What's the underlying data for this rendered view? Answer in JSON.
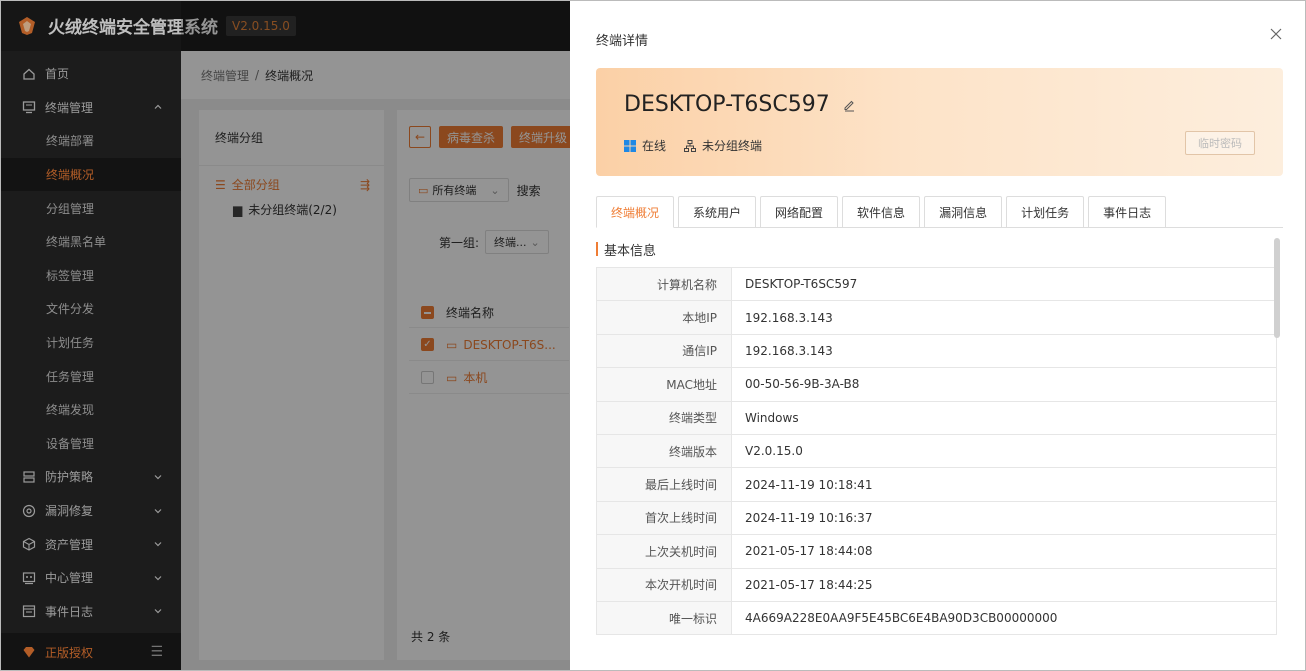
{
  "app": {
    "title": "火绒终端安全管理系统",
    "version": "V2.0.15.0",
    "brand_color": "#ef7d35"
  },
  "sidebar": {
    "items": [
      {
        "label": "首页",
        "icon": "home-icon"
      },
      {
        "label": "终端管理",
        "icon": "monitor-icon",
        "expanded": true
      },
      {
        "label": "防护策略",
        "icon": "shield-policy-icon"
      },
      {
        "label": "漏洞修复",
        "icon": "target-icon"
      },
      {
        "label": "资产管理",
        "icon": "box-icon"
      },
      {
        "label": "中心管理",
        "icon": "server-icon"
      },
      {
        "label": "事件日志",
        "icon": "log-icon"
      }
    ],
    "submenu": [
      {
        "label": "终端部署"
      },
      {
        "label": "终端概况",
        "active": true
      },
      {
        "label": "分组管理"
      },
      {
        "label": "终端黑名单"
      },
      {
        "label": "标签管理"
      },
      {
        "label": "文件分发"
      },
      {
        "label": "计划任务"
      },
      {
        "label": "任务管理"
      },
      {
        "label": "终端发现"
      },
      {
        "label": "设备管理"
      }
    ],
    "footer": {
      "label": "正版授权"
    }
  },
  "main": {
    "breadcrumb": {
      "parent": "终端管理",
      "sep": "/",
      "current": "终端概况"
    },
    "group_panel": {
      "title": "终端分组",
      "all": "全部分组",
      "sub": "未分组终端(2/2)"
    },
    "toolbar": {
      "virus_scan": "病毒查杀",
      "upgrade": "终端升级"
    },
    "filter": {
      "scope": "所有终端",
      "search": "搜索"
    },
    "group_filter": {
      "label": "第一组:",
      "value": "终端..."
    },
    "table": {
      "header": "终端名称",
      "rows": [
        {
          "name": "DESKTOP-T6S...",
          "checked": true
        },
        {
          "name": "本机",
          "checked": false
        }
      ]
    },
    "total": "共 2 条"
  },
  "drawer": {
    "title": "终端详情",
    "hostname": "DESKTOP-T6SC597",
    "status": "在线",
    "group": "未分组终端",
    "temp_password": "临时密码",
    "tabs": [
      "终端概况",
      "系统用户",
      "网络配置",
      "软件信息",
      "漏洞信息",
      "计划任务",
      "事件日志"
    ],
    "section_title": "基本信息",
    "info": [
      {
        "key": "计算机名称",
        "value": "DESKTOP-T6SC597"
      },
      {
        "key": "本地IP",
        "value": "192.168.3.143"
      },
      {
        "key": "通信IP",
        "value": "192.168.3.143"
      },
      {
        "key": "MAC地址",
        "value": "00-50-56-9B-3A-B8"
      },
      {
        "key": "终端类型",
        "value": "Windows"
      },
      {
        "key": "终端版本",
        "value": "V2.0.15.0"
      },
      {
        "key": "最后上线时间",
        "value": "2024-11-19 10:18:41"
      },
      {
        "key": "首次上线时间",
        "value": "2024-11-19 10:16:37"
      },
      {
        "key": "上次关机时间",
        "value": "2021-05-17 18:44:08"
      },
      {
        "key": "本次开机时间",
        "value": "2021-05-17 18:44:25"
      },
      {
        "key": "唯一标识",
        "value": "4A669A228E0AA9F5E45BC6E4BA90D3CB00000000"
      }
    ]
  }
}
